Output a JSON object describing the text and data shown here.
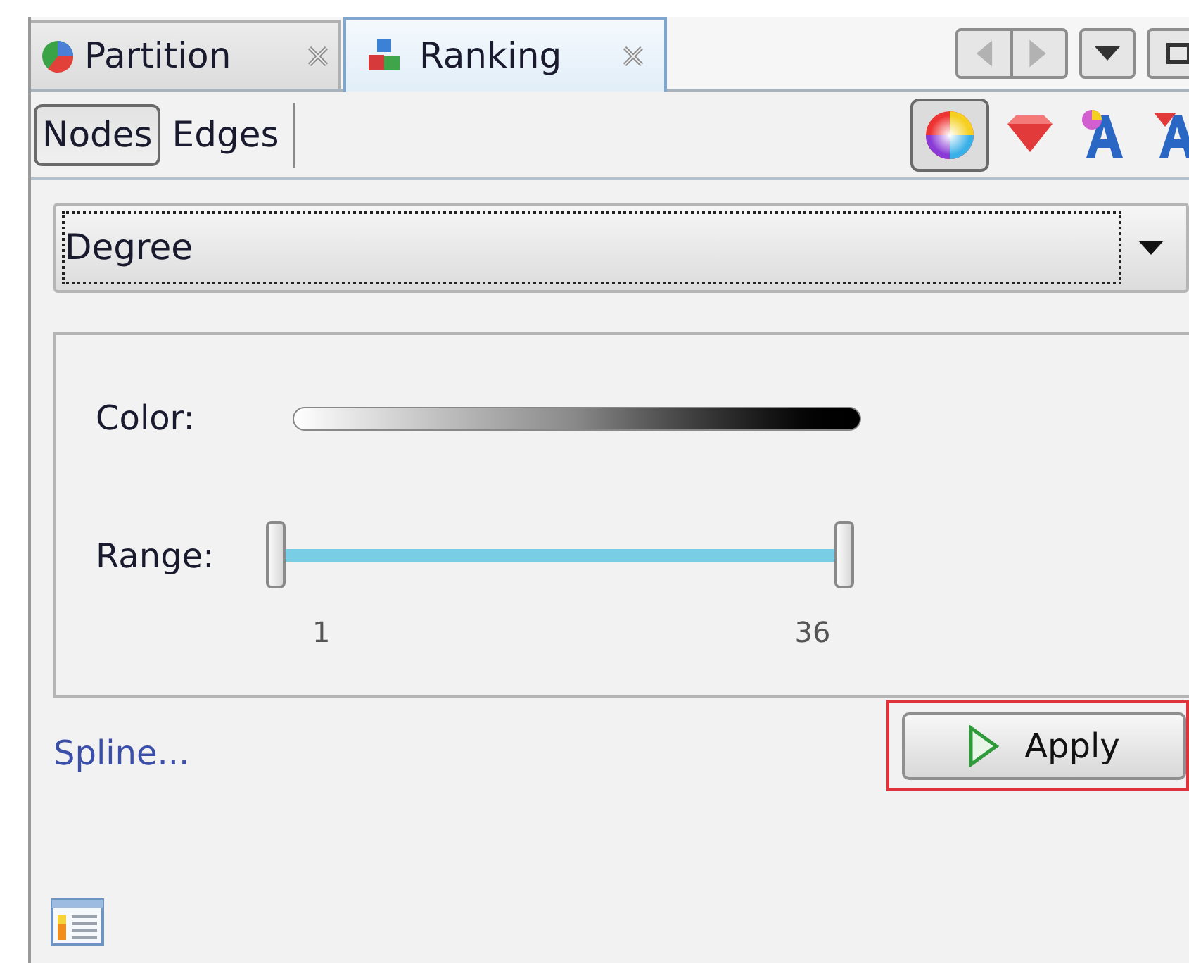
{
  "tabs": [
    {
      "label": "Partition",
      "kind": "pie",
      "selected": false
    },
    {
      "label": "Ranking",
      "kind": "blocks",
      "selected": true
    }
  ],
  "mode_buttons": [
    {
      "label": "Nodes",
      "selected": true
    },
    {
      "label": "Edges",
      "selected": false
    }
  ],
  "transform_buttons": [
    {
      "kind": "color",
      "selected": true
    },
    {
      "kind": "size",
      "selected": false
    },
    {
      "kind": "label_color",
      "selected": false
    },
    {
      "kind": "label_size",
      "selected": false
    }
  ],
  "attribute_dropdown": {
    "value": "Degree"
  },
  "color": {
    "label": "Color:"
  },
  "range": {
    "label": "Range:",
    "thumbs": [
      {
        "level": 0
      },
      {
        "level": 1
      }
    ],
    "min": "1",
    "max": "36"
  },
  "spline_link": "Spline...",
  "apply_button": {
    "label": "Apply",
    "highlighted": true
  }
}
